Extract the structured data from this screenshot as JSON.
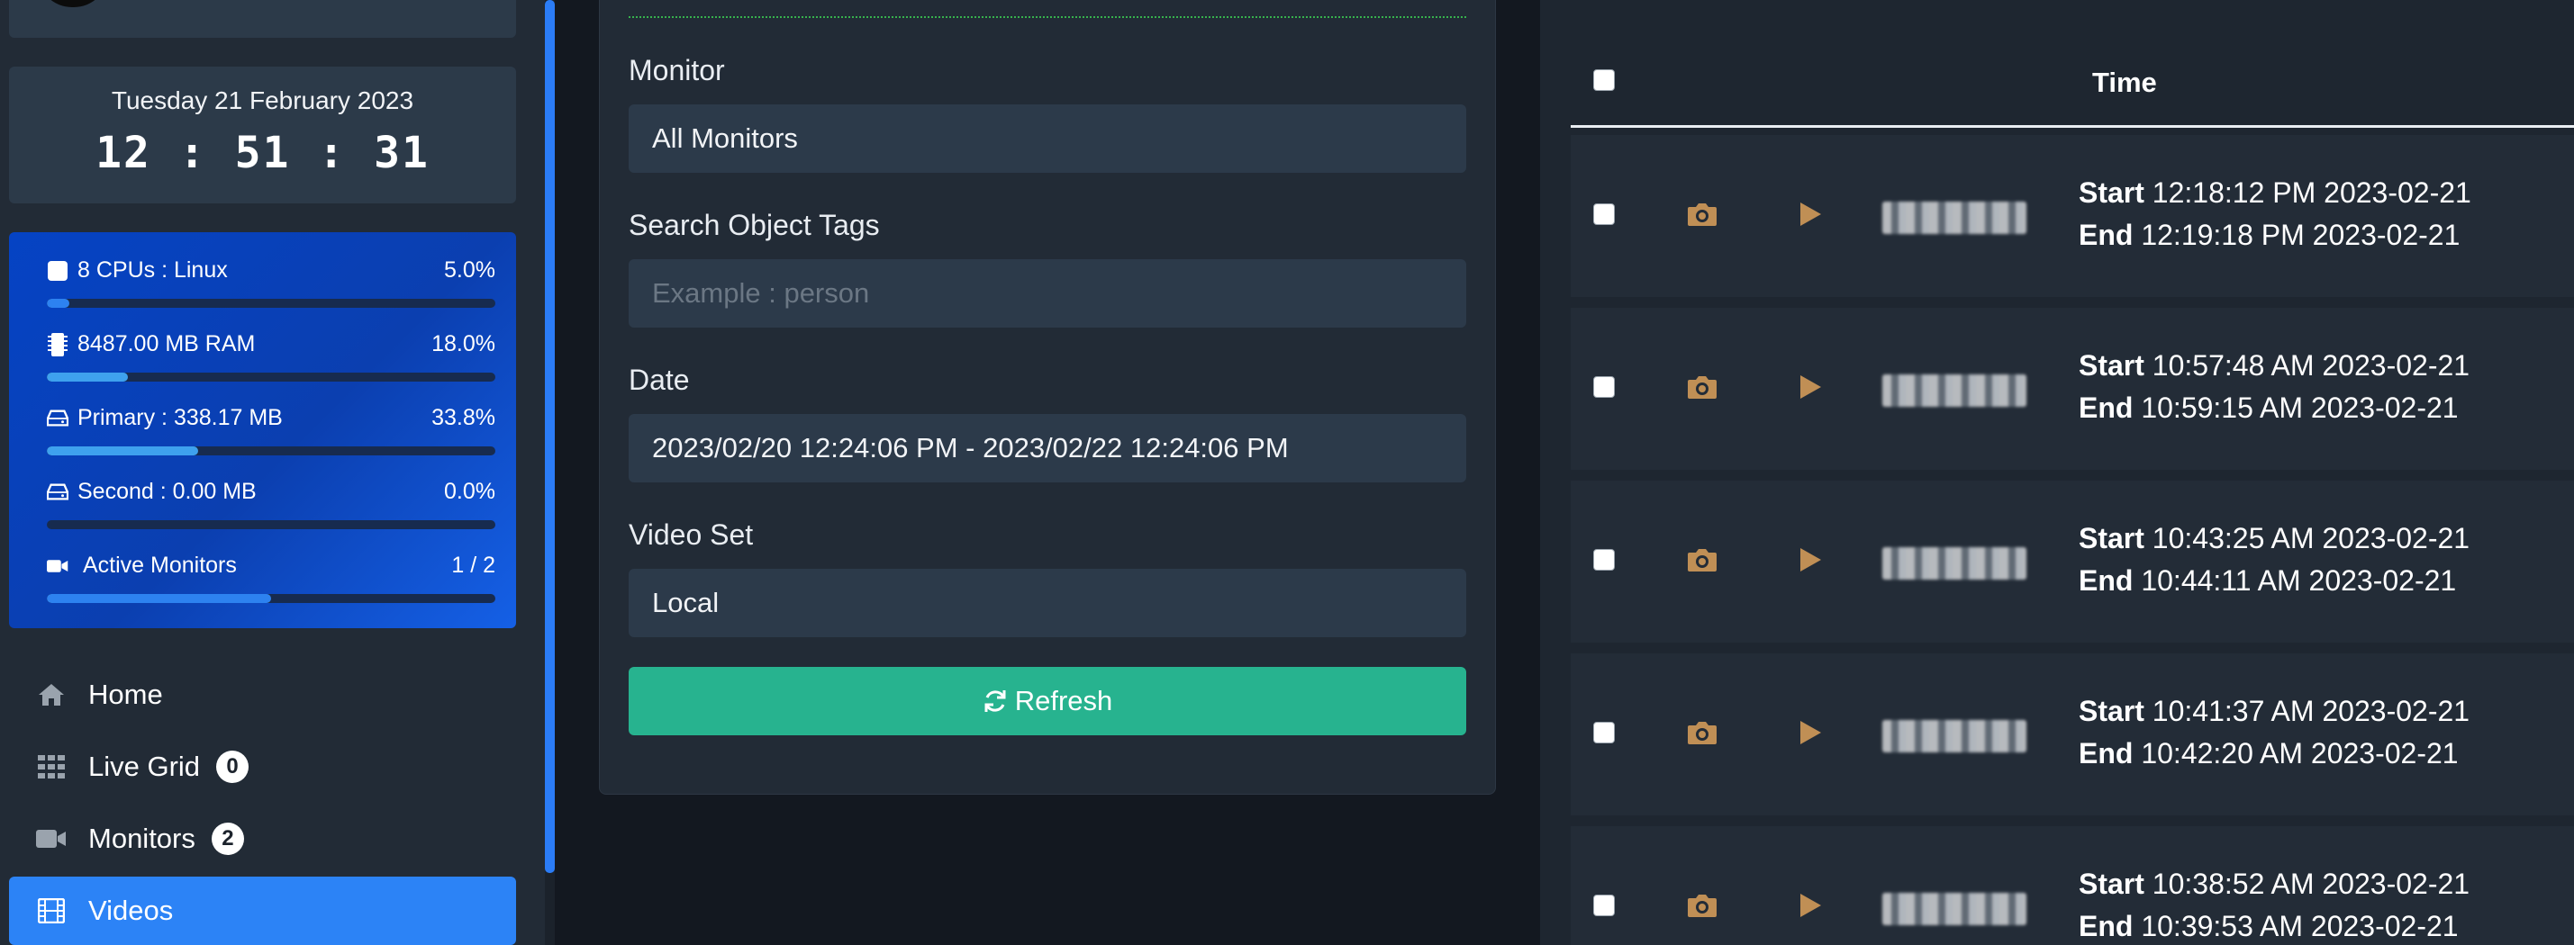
{
  "sidebar": {
    "clock": {
      "date": "Tuesday 21 February 2023",
      "time": "12 : 51 : 31"
    },
    "stats": [
      {
        "label": "8 CPUs : Linux",
        "value": "5.0%",
        "fill": 0.05,
        "icon": "cpu-icon"
      },
      {
        "label": "8487.00 MB RAM",
        "value": "18.0%",
        "fill": 0.18,
        "icon": "memory-icon"
      },
      {
        "label": "Primary : 338.17 MB",
        "value": "33.8%",
        "fill": 0.338,
        "icon": "hard-drive-icon"
      },
      {
        "label": "Second : 0.00 MB",
        "value": "0.0%",
        "fill": 0.0,
        "icon": "hard-drive-icon"
      },
      {
        "label": "Active Monitors",
        "value": "1 / 2",
        "fill": 0.5,
        "icon": "video-camera-icon"
      }
    ],
    "nav": [
      {
        "label": "Home",
        "icon": "home-icon"
      },
      {
        "label": "Live Grid",
        "badge": "0",
        "icon": "grid-icon"
      },
      {
        "label": "Monitors",
        "badge": "2",
        "icon": "video-camera-icon"
      },
      {
        "label": "Videos",
        "icon": "film-icon",
        "active": true
      }
    ]
  },
  "filters": {
    "monitor_label": "Monitor",
    "monitor_value": "All Monitors",
    "tags_label": "Search Object Tags",
    "tags_placeholder": "Example : person",
    "date_label": "Date",
    "date_value": "2023/02/20 12:24:06 PM - 2023/02/22 12:24:06 PM",
    "videoset_label": "Video Set",
    "videoset_value": "Local",
    "refresh_label": "Refresh"
  },
  "table": {
    "header_time": "Time",
    "start_label": "Start",
    "end_label": "End",
    "rows": [
      {
        "start": "12:18:12 PM 2023-02-21",
        "end": "12:19:18 PM 2023-02-21"
      },
      {
        "start": "10:57:48 AM 2023-02-21",
        "end": "10:59:15 AM 2023-02-21"
      },
      {
        "start": "10:43:25 AM 2023-02-21",
        "end": "10:44:11 AM 2023-02-21"
      },
      {
        "start": "10:41:37 AM 2023-02-21",
        "end": "10:42:20 AM 2023-02-21"
      },
      {
        "start": "10:38:52 AM 2023-02-21",
        "end": "10:39:53 AM 2023-02-21"
      }
    ]
  },
  "colors": {
    "accent": "#2c83f6",
    "refresh": "#27b38f",
    "row_icon": "#c08f55"
  }
}
